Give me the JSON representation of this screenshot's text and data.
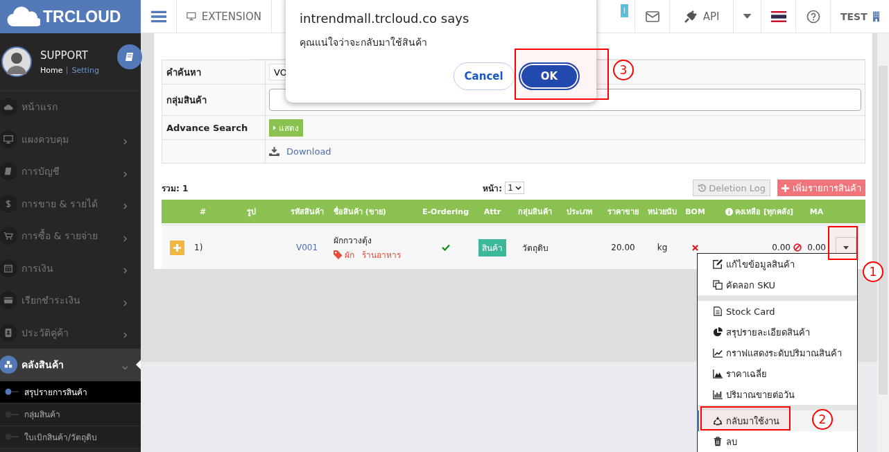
{
  "brand": {
    "name": "TRCLOUD"
  },
  "profile": {
    "name": "SUPPORT",
    "links": [
      "Home",
      "Setting"
    ]
  },
  "sidebar": {
    "items": [
      {
        "label": "หน้าแรก",
        "expandable": false,
        "expanded": false,
        "selected": false
      },
      {
        "label": "แผงควบคุม",
        "expandable": true,
        "expanded": false,
        "selected": false
      },
      {
        "label": "การบัญชี",
        "expandable": true,
        "expanded": false,
        "selected": false
      },
      {
        "label": "การขาย & รายได้",
        "expandable": true,
        "expanded": false,
        "selected": false
      },
      {
        "label": "การซื้อ & รายจ่าย",
        "expandable": true,
        "expanded": false,
        "selected": false
      },
      {
        "label": "การเงิน",
        "expandable": true,
        "expanded": false,
        "selected": false
      },
      {
        "label": "เรียกชำระเงิน",
        "expandable": true,
        "expanded": false,
        "selected": false
      },
      {
        "label": "ประวัติคู่ค้า",
        "expandable": true,
        "expanded": false,
        "selected": false
      },
      {
        "label": "คลังสินค้า",
        "expandable": true,
        "expanded": true,
        "selected": true,
        "children": [
          {
            "label": "สรุปรายการสินค้า",
            "selected": true
          },
          {
            "label": "กลุ่มสินค้า",
            "selected": false
          },
          {
            "label": "ใบเบิกสินค้า/วัตถุดิบ",
            "selected": false
          }
        ]
      }
    ]
  },
  "topbar": {
    "extension": "EXTENSION",
    "badge": "I",
    "api": "API",
    "user": "TEST"
  },
  "dialog": {
    "title": "intrendmall.trcloud.co says",
    "message": "คุณแน่ใจว่าจะกลับมาใช้สินค้า",
    "buttons": [
      {
        "label": "Cancel",
        "primary": false
      },
      {
        "label": "OK",
        "primary": true
      }
    ]
  },
  "search": {
    "rows": [
      {
        "kind": "input",
        "label": "คำค้นหา",
        "value": "VO"
      },
      {
        "kind": "input",
        "label": "กลุ่มสินค้า"
      },
      {
        "kind": "toggle",
        "label": "Advance Search",
        "button": "แสดง"
      },
      {
        "kind": "link",
        "link": "Download"
      }
    ]
  },
  "summary": {
    "total": "รวม: 1",
    "page_label": "หน้า:",
    "page": "1",
    "deletion_log": "Deletion Log",
    "add": "เพิ่มรายการสินค้า"
  },
  "table": {
    "columns": [
      "#",
      "รูป",
      "รหัสสินค้า",
      "ชื่อสินค้า (ขาย)",
      "E-Ordering",
      "Attr",
      "กลุ่มสินค้า",
      "ประเภท",
      "ราคาขาย",
      "หน่วยนับ",
      "BOM",
      "คงเหลือ [ทุกคลัง]",
      "MA"
    ],
    "rows": [
      {
        "number": "1)",
        "code": "V001",
        "name": "ผักกวางตุ้ง",
        "tags": [
          "ผัก",
          "ร้านอาหาร"
        ],
        "e_ordering": true,
        "attr": "สินค้า",
        "group": "วัตถุดิบ",
        "price": "20.00",
        "unit": "kg",
        "bom": false,
        "stock": "0.00",
        "ma": "0.00"
      }
    ]
  },
  "menu": {
    "groups": [
      [
        {
          "label": "แก้ไขข้อมูลสินค้า",
          "selected": false
        },
        {
          "label": "คัดลอก SKU",
          "selected": false
        }
      ],
      [
        {
          "label": "Stock Card",
          "selected": false
        },
        {
          "label": "สรุปรายละเอียดสินค้า",
          "selected": false
        },
        {
          "label": "กราฟแสดงระดับปริมาณสินค้า",
          "selected": false
        },
        {
          "label": "ราคาเฉลี่ย",
          "selected": false
        },
        {
          "label": "ปริมาณขายต่อวัน",
          "selected": false
        }
      ],
      [
        {
          "label": "กลับมาใช้งาน",
          "selected": true
        },
        {
          "label": "ลบ",
          "selected": false
        }
      ]
    ]
  },
  "annotations": [
    {
      "label": "1"
    },
    {
      "label": "2"
    },
    {
      "label": "3"
    }
  ]
}
